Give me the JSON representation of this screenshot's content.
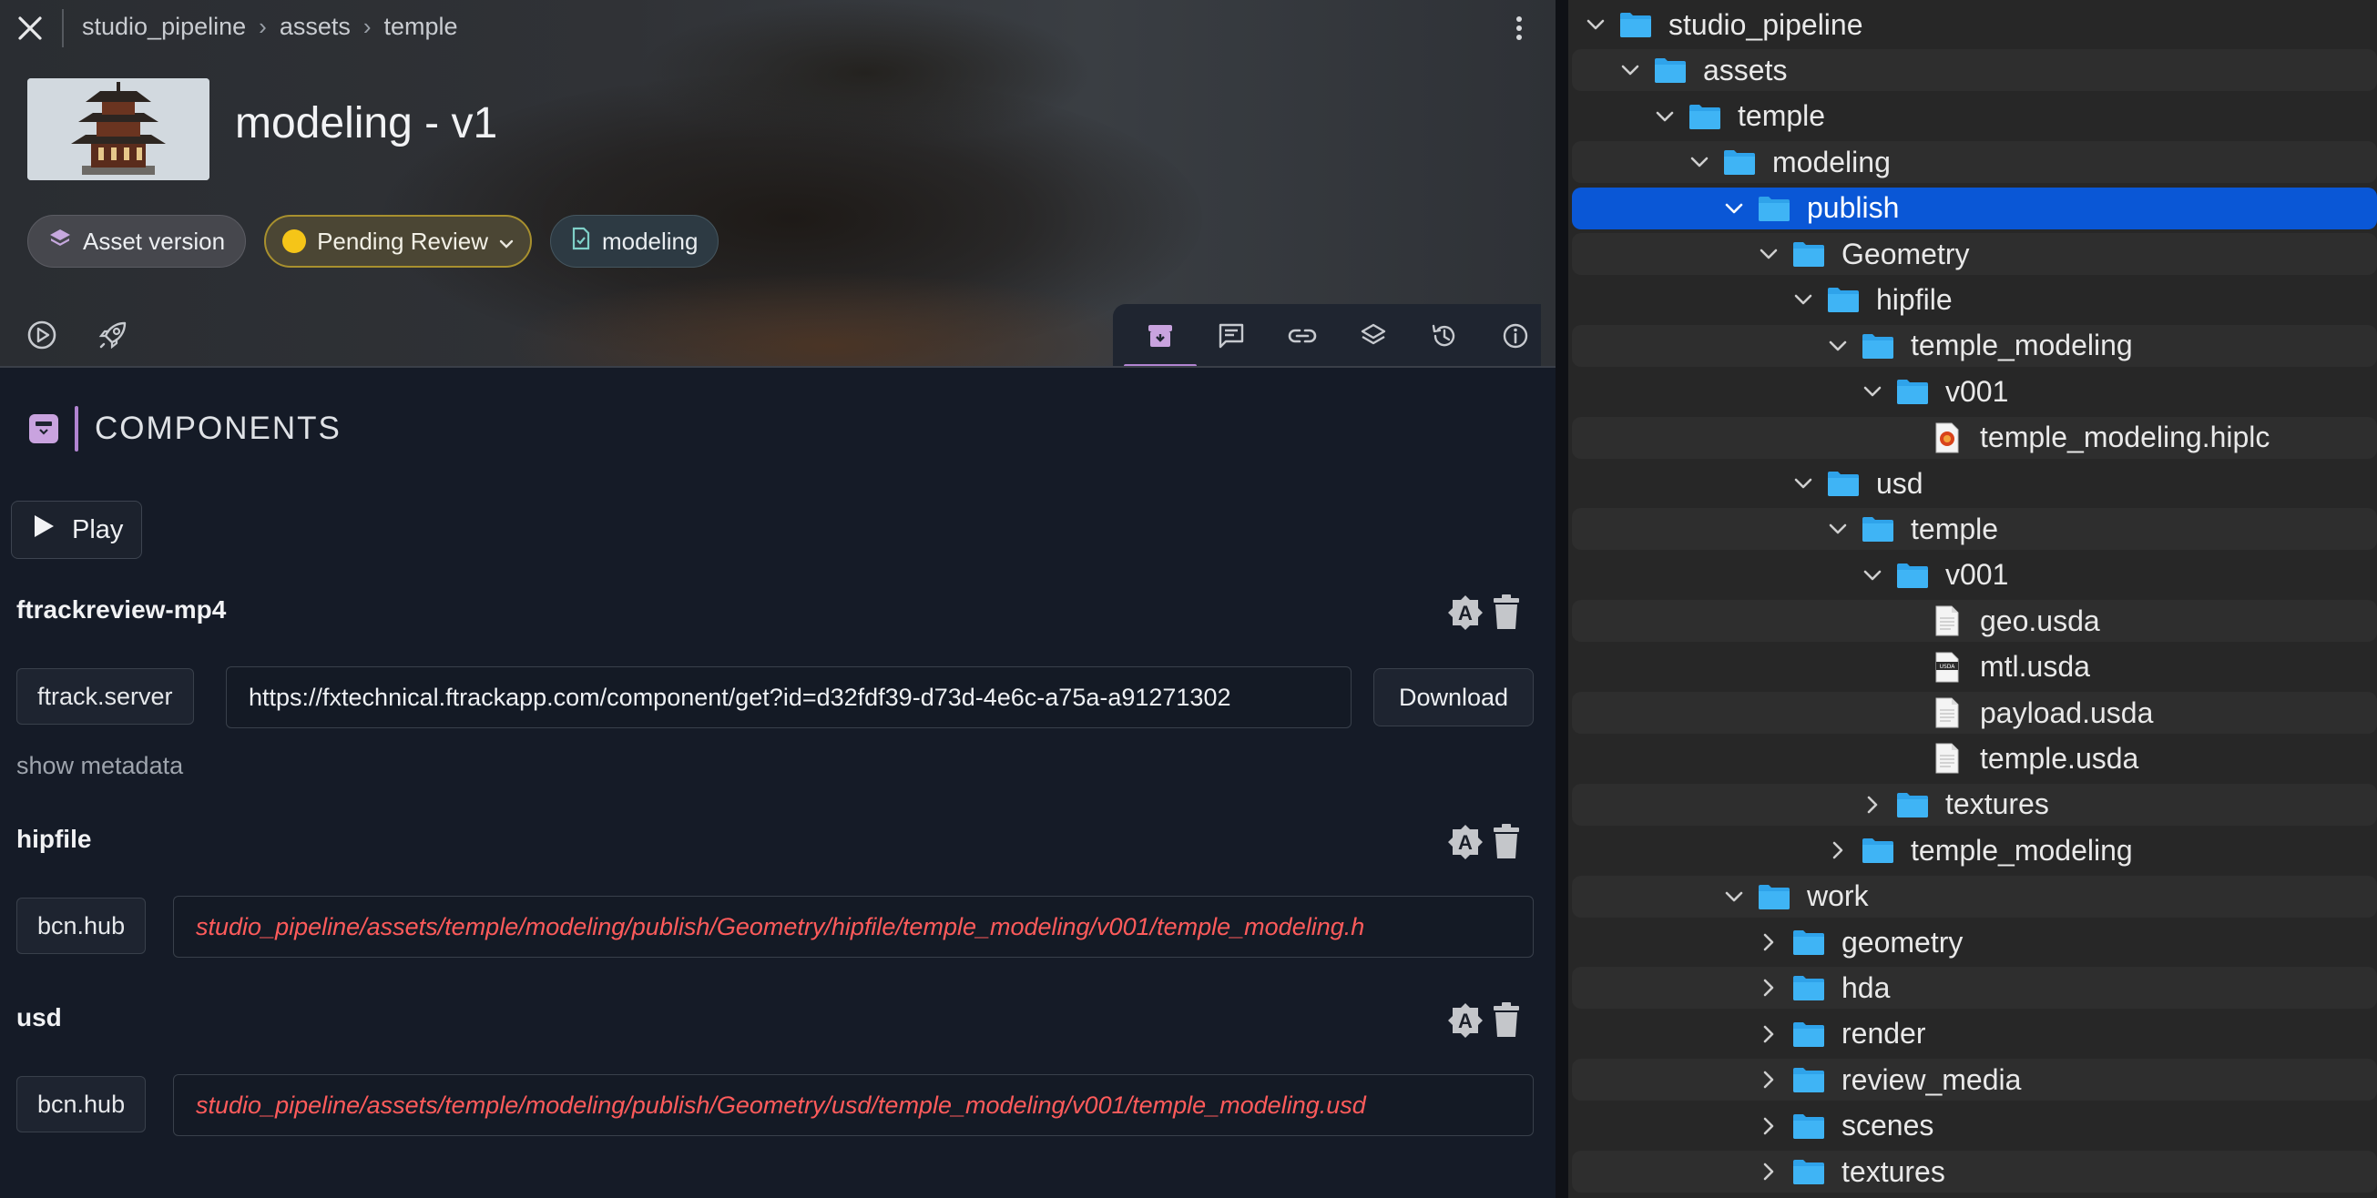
{
  "header": {
    "breadcrumb": [
      "studio_pipeline",
      "assets",
      "temple"
    ],
    "title": "modeling - v1",
    "chips": {
      "asset_version": "Asset version",
      "status": "Pending Review",
      "type": "modeling"
    },
    "colors": {
      "status_dot": "#f5c518",
      "accent": "#b184d1"
    }
  },
  "tabs": [
    "components-icon",
    "notes-icon",
    "links-icon",
    "layers-icon",
    "history-icon",
    "info-icon"
  ],
  "section": {
    "title": "COMPONENTS"
  },
  "play_label": "Play",
  "components": [
    {
      "name": "ftrackreview-mp4",
      "location": "ftrack.server",
      "path": "https://fxtechnical.ftrackapp.com/component/get?id=d32fdf39-d73d-4e6c-a75a-a91271302",
      "download_label": "Download",
      "show_metadata": "show metadata"
    },
    {
      "name": "hipfile",
      "location": "bcn.hub",
      "path": "studio_pipeline/assets/temple/modeling/publish/Geometry/hipfile/temple_modeling/v001/temple_modeling.h"
    },
    {
      "name": "usd",
      "location": "bcn.hub",
      "path": "studio_pipeline/assets/temple/modeling/publish/Geometry/usd/temple_modeling/v001/temple_modeling.usd"
    }
  ],
  "tree": [
    {
      "label": "studio_pipeline",
      "depth": 0,
      "expanded": true,
      "kind": "folder"
    },
    {
      "label": "assets",
      "depth": 1,
      "expanded": true,
      "kind": "folder"
    },
    {
      "label": "temple",
      "depth": 2,
      "expanded": true,
      "kind": "folder"
    },
    {
      "label": "modeling",
      "depth": 3,
      "expanded": true,
      "kind": "folder"
    },
    {
      "label": "publish",
      "depth": 4,
      "expanded": true,
      "kind": "folder",
      "selected": true
    },
    {
      "label": "Geometry",
      "depth": 5,
      "expanded": true,
      "kind": "folder"
    },
    {
      "label": "hipfile",
      "depth": 6,
      "expanded": true,
      "kind": "folder"
    },
    {
      "label": "temple_modeling",
      "depth": 7,
      "expanded": true,
      "kind": "folder"
    },
    {
      "label": "v001",
      "depth": 8,
      "expanded": true,
      "kind": "folder"
    },
    {
      "label": "temple_modeling.hiplc",
      "depth": 9,
      "kind": "hip"
    },
    {
      "label": "usd",
      "depth": 6,
      "expanded": true,
      "kind": "folder"
    },
    {
      "label": "temple",
      "depth": 7,
      "expanded": true,
      "kind": "folder"
    },
    {
      "label": "v001",
      "depth": 8,
      "expanded": true,
      "kind": "folder"
    },
    {
      "label": "geo.usda",
      "depth": 9,
      "kind": "doc"
    },
    {
      "label": "mtl.usda",
      "depth": 9,
      "kind": "usda"
    },
    {
      "label": "payload.usda",
      "depth": 9,
      "kind": "doc"
    },
    {
      "label": "temple.usda",
      "depth": 9,
      "kind": "doc"
    },
    {
      "label": "textures",
      "depth": 8,
      "expanded": false,
      "kind": "folder"
    },
    {
      "label": "temple_modeling",
      "depth": 7,
      "expanded": false,
      "kind": "folder"
    },
    {
      "label": "work",
      "depth": 4,
      "expanded": true,
      "kind": "folder"
    },
    {
      "label": "geometry",
      "depth": 5,
      "expanded": false,
      "kind": "folder"
    },
    {
      "label": "hda",
      "depth": 5,
      "expanded": false,
      "kind": "folder"
    },
    {
      "label": "render",
      "depth": 5,
      "expanded": false,
      "kind": "folder"
    },
    {
      "label": "review_media",
      "depth": 5,
      "expanded": false,
      "kind": "folder"
    },
    {
      "label": "scenes",
      "depth": 5,
      "expanded": false,
      "kind": "folder"
    },
    {
      "label": "textures",
      "depth": 5,
      "expanded": false,
      "kind": "folder"
    }
  ]
}
